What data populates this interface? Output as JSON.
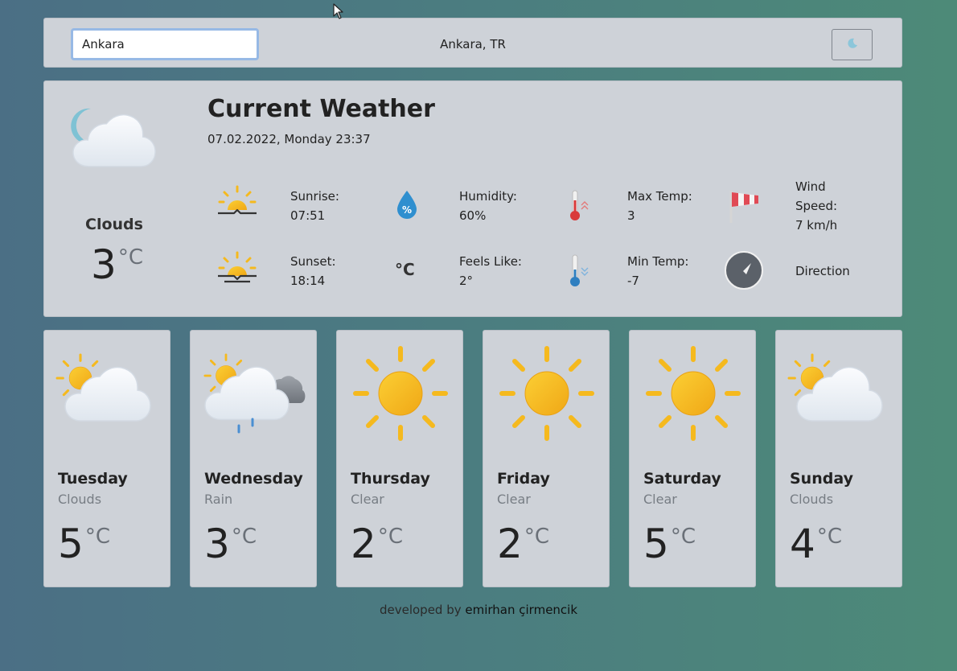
{
  "search": {
    "value": "Ankara",
    "placeholder": ""
  },
  "header": {
    "location": "Ankara, TR",
    "theme_icon": "moon-icon"
  },
  "current": {
    "title": "Current Weather",
    "datetime": "07.02.2022, Monday 23:37",
    "description": "Clouds",
    "temp": "3",
    "unit": "°C",
    "icon": "cloud-moon-icon",
    "stats": {
      "sunrise": {
        "label": "Sunrise:",
        "value": "07:51",
        "icon": "sunrise-icon"
      },
      "humidity": {
        "label": "Humidity:",
        "value": "60%",
        "icon": "humidity-icon"
      },
      "max_temp": {
        "label": "Max Temp:",
        "value": "3",
        "icon": "thermometer-hot-icon"
      },
      "wind_speed": {
        "label_line1": "Wind",
        "label_line2": "Speed:",
        "value": "7 km/h",
        "icon": "windsock-icon"
      },
      "sunset": {
        "label": "Sunset:",
        "value": "18:14",
        "icon": "sunset-icon"
      },
      "feels_like": {
        "label": "Feels Like:",
        "value": "2°",
        "icon": "celsius-icon",
        "icon_text": "°C"
      },
      "min_temp": {
        "label": "Min Temp:",
        "value": "-7",
        "icon": "thermometer-cold-icon"
      },
      "direction": {
        "label": "Direction",
        "icon": "compass-icon"
      }
    }
  },
  "forecast": [
    {
      "day": "Tuesday",
      "desc": "Clouds",
      "temp": "5",
      "unit": "°C",
      "icon": "partly-cloudy-icon"
    },
    {
      "day": "Wednesday",
      "desc": "Rain",
      "temp": "3",
      "unit": "°C",
      "icon": "rain-icon"
    },
    {
      "day": "Thursday",
      "desc": "Clear",
      "temp": "2",
      "unit": "°C",
      "icon": "sun-icon"
    },
    {
      "day": "Friday",
      "desc": "Clear",
      "temp": "2",
      "unit": "°C",
      "icon": "sun-icon"
    },
    {
      "day": "Saturday",
      "desc": "Clear",
      "temp": "5",
      "unit": "°C",
      "icon": "sun-icon"
    },
    {
      "day": "Sunday",
      "desc": "Clouds",
      "temp": "4",
      "unit": "°C",
      "icon": "partly-cloudy-icon"
    }
  ],
  "footer": {
    "prefix": "developed by ",
    "author": "emirhan çirmencik"
  },
  "colors": {
    "panel": "#ced2d8",
    "sun": "#f5b91e",
    "cloud": "#f4f7fb",
    "accent": "#3b8fd0"
  }
}
